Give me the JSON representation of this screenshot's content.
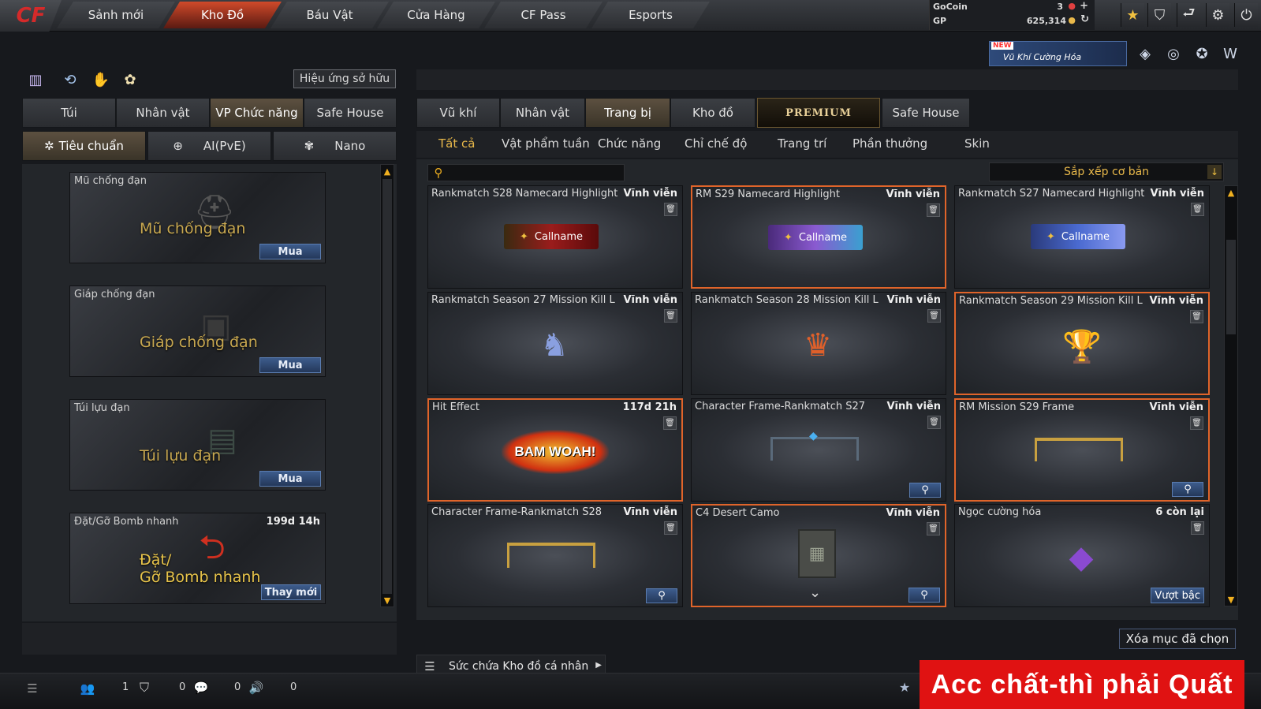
{
  "topnav": {
    "logo": "CF",
    "tabs": [
      "Sảnh mới",
      "Kho Đồ",
      "Báu Vật",
      "Cửa Hàng",
      "CF Pass",
      "Esports"
    ],
    "active_tab": "Kho Đồ"
  },
  "wallet": {
    "gocoin_label": "GoCoin",
    "gocoin_value": "3",
    "gp_label": "GP",
    "gp_value": "625,314"
  },
  "banner": {
    "new_badge": "NEW",
    "text": "Vũ Khí Cường Hóa"
  },
  "left": {
    "owned_effect_button": "Hiệu ứng sở hữu",
    "tabs": [
      "Túi",
      "Nhân vật",
      "VP Chức năng",
      "Safe House"
    ],
    "active_tab": "VP Chức năng",
    "subtabs": [
      "Tiêu chuẩn",
      "AI(PvE)",
      "Nano"
    ],
    "active_subtab": "Tiêu chuẩn",
    "items": [
      {
        "name": "Mũ chống đạn",
        "big_label": "Mũ chống đạn",
        "time": "",
        "action": "Mua"
      },
      {
        "name": "Giáp chống đạn",
        "big_label": "Giáp chống đạn",
        "time": "",
        "action": "Mua"
      },
      {
        "name": "Túi lựu đạn",
        "big_label": "Túi lựu đạn",
        "time": "",
        "action": "Mua"
      },
      {
        "name": "Đặt/Gỡ Bomb nhanh",
        "big_label_1": "Đặt/",
        "big_label_2": "Gỡ Bomb nhanh",
        "time": "199d 14h",
        "action": "Thay mới"
      }
    ]
  },
  "right": {
    "tabs": [
      "Vũ khí",
      "Nhân vật",
      "Trang bị",
      "Kho đồ",
      "PREMIUM",
      "Safe House"
    ],
    "active_tab": "Trang bị",
    "filters": [
      "Tất cả",
      "Vật phẩm tuần",
      "Chức năng",
      "Chỉ chế độ",
      "Trang trí",
      "Phần thưởng",
      "Skin"
    ],
    "active_filter": "Tất cả",
    "search_placeholder": "",
    "sort_label": "Sắp xếp cơ bản",
    "items": [
      {
        "name": "Rankmatch S28 Namecard Highlight",
        "time": "Vĩnh viễn",
        "visual": "callname-red",
        "callname": "Callname",
        "selected": false,
        "button": ""
      },
      {
        "name": "RM S29 Namecard Highlight",
        "time": "Vĩnh viễn",
        "visual": "callname-purple",
        "callname": "Callname",
        "selected": true,
        "button": ""
      },
      {
        "name": "Rankmatch S27 Namecard Highlight",
        "time": "Vĩnh viễn",
        "visual": "callname-blue",
        "callname": "Callname",
        "selected": false,
        "button": ""
      },
      {
        "name": "Rankmatch Season 27 Mission Kill L",
        "time": "Vĩnh viễn",
        "visual": "badge-horse",
        "selected": false,
        "button": ""
      },
      {
        "name": "Rankmatch Season 28 Mission Kill L",
        "time": "Vĩnh viễn",
        "visual": "badge-fire",
        "selected": false,
        "button": ""
      },
      {
        "name": "Rankmatch Season 29 Mission Kill L",
        "time": "Vĩnh viễn",
        "visual": "badge-trophy",
        "selected": true,
        "button": ""
      },
      {
        "name": "Hit Effect",
        "time": "117d 21h",
        "visual": "bam-effect",
        "effect_text": "BAM WOAH!",
        "selected": true,
        "button": ""
      },
      {
        "name": "Character Frame-Rankmatch S27",
        "time": "Vĩnh viễn",
        "visual": "frame-blue",
        "selected": false,
        "button": "zoom"
      },
      {
        "name": "RM Mission S29 Frame",
        "time": "Vĩnh viễn",
        "visual": "frame-gold",
        "selected": true,
        "button": "zoom"
      },
      {
        "name": "Character Frame-Rankmatch S28",
        "time": "Vĩnh viễn",
        "visual": "frame-gold2",
        "selected": false,
        "button": "zoom"
      },
      {
        "name": "C4 Desert Camo",
        "time": "Vĩnh viễn",
        "visual": "c4",
        "selected": true,
        "button": "zoom"
      },
      {
        "name": "Ngọc cường hóa",
        "time": "6 còn lại",
        "visual": "gem",
        "selected": false,
        "button": "Vượt bậc"
      }
    ],
    "delete_button": "Xóa mục đã chọn",
    "capacity_label": "Sức chứa Kho đồ cá nhân"
  },
  "statusbar": {
    "friends": "1",
    "shield": "0",
    "chat": "0",
    "volume": "0"
  },
  "promo": "Acc chất-thì phải Quất",
  "colors": {
    "accent_orange": "#e0642a",
    "gold": "#e8b84a",
    "red_banner": "#e01212",
    "button_blue": "#3d5c8c"
  }
}
